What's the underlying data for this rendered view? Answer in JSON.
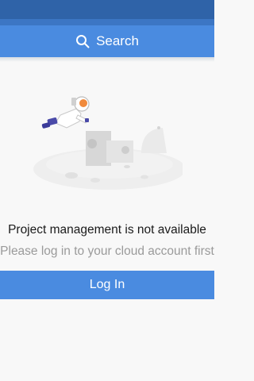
{
  "search": {
    "label": "Search",
    "icon": "search-icon"
  },
  "empty_state": {
    "illustration": "astronaut-moon-illustration",
    "title": "Project management is not available",
    "subtitle": "Please log in to your cloud account first"
  },
  "login_button": {
    "label": "Log In"
  },
  "colors": {
    "status_bar": "#2f63a8",
    "accent": "#4a8be0",
    "background": "#f8f8f8",
    "title_text": "#1a1a1a",
    "subtitle_text": "#9a9a9a"
  }
}
